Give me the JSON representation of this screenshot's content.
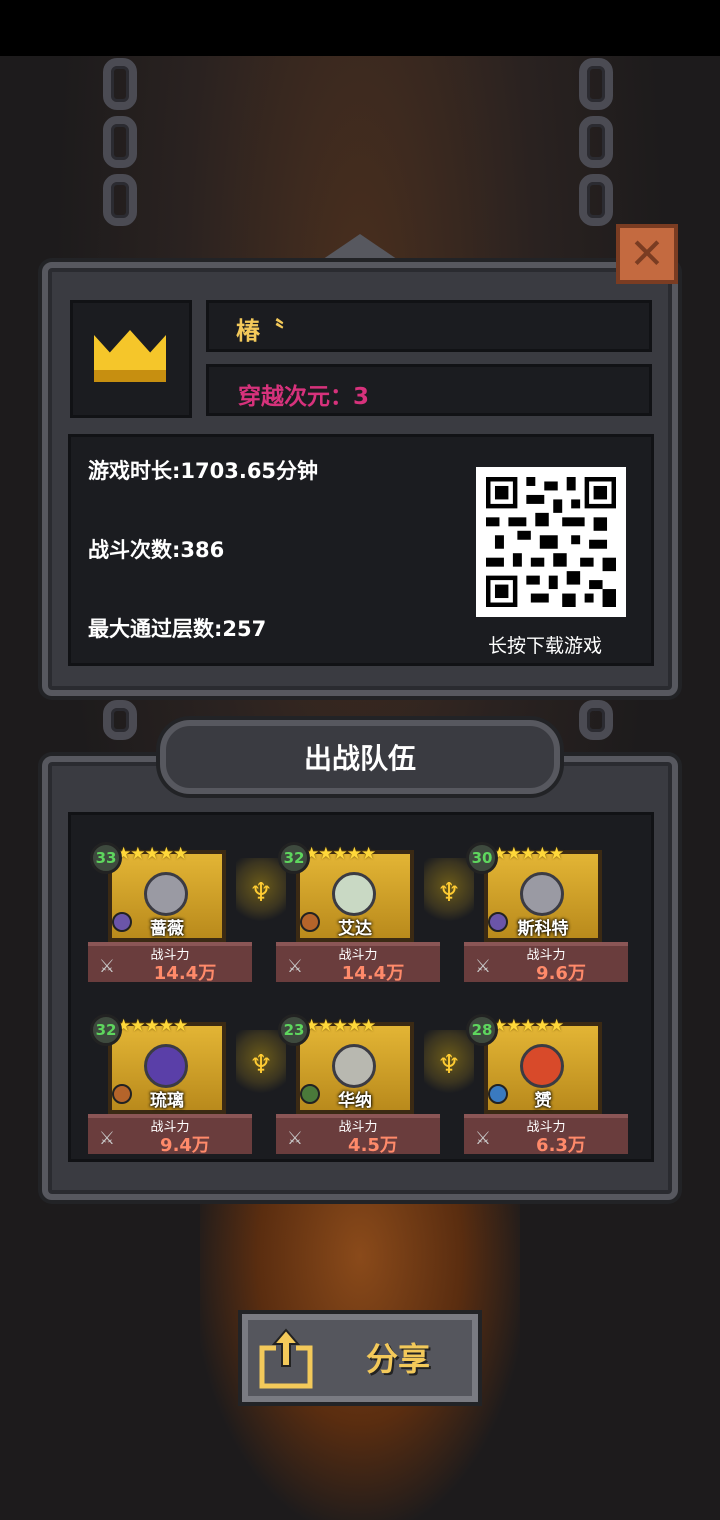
{
  "profile": {
    "name": "椿〝",
    "dimension_label": "穿越次元：",
    "dimension_value": "3"
  },
  "stats": {
    "play_time": "游戏时长:1703.65分钟",
    "battles": "战斗次数:386",
    "max_floor": "最大通过层数:257"
  },
  "qr": {
    "caption": "长按下载游戏"
  },
  "team": {
    "title": "出战队伍",
    "power_label": "战斗力",
    "heroes": [
      {
        "level": "33",
        "name": "蔷薇",
        "power": "14.4万",
        "stars": "★★★★★"
      },
      {
        "level": "32",
        "name": "艾达",
        "power": "14.4万",
        "stars": "★★★★★"
      },
      {
        "level": "30",
        "name": "斯科特",
        "power": "9.6万",
        "stars": "★★★★★"
      },
      {
        "level": "32",
        "name": "琉璃",
        "power": "9.4万",
        "stars": "★★★★★"
      },
      {
        "level": "23",
        "name": "华纳",
        "power": "4.5万",
        "stars": "★★★★★"
      },
      {
        "level": "28",
        "name": "赟",
        "power": "6.3万",
        "stars": "★★★★★"
      }
    ]
  },
  "share": {
    "label": "分享"
  },
  "icons": {
    "close": "close-icon",
    "crown": "crown-icon",
    "share": "share-icon",
    "swords": "crossed-swords-icon",
    "torch": "torch-icon"
  },
  "colors": {
    "name": "#f3c95a",
    "dimension": "#d7327c",
    "close_button": "#c46a40",
    "power": "#ff8a6a",
    "level": "#5ed65e"
  }
}
